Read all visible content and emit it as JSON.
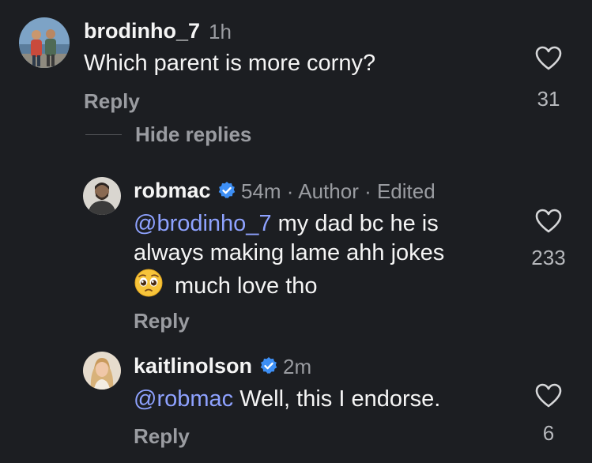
{
  "colors": {
    "background": "#1c1e22",
    "mention": "#8ea2ff",
    "verified_badge": "#3d8ff5",
    "secondary_text": "#9a9ca1"
  },
  "comment": {
    "username": "brodinho_7",
    "time": "1h",
    "text": "Which parent is more corny?",
    "reply_label": "Reply",
    "like_count": "31",
    "avatar_icon": "avatar-photo",
    "heart_icon": "heart-outline-icon"
  },
  "thread": {
    "hide_replies_label": "Hide replies"
  },
  "replies": [
    {
      "username": "robmac",
      "verified": true,
      "meta": "54m · Author · Edited",
      "mention": "@brodinho_7",
      "text_line1": " my  dad bc he is",
      "text_line2": "always making lame ahh jokes",
      "text_line3": "much love tho",
      "emoji_icon": "pleading-face-emoji",
      "reply_label": "Reply",
      "like_count": "233"
    },
    {
      "username": "kaitlinolson",
      "verified": true,
      "meta": "2m",
      "mention": "@robmac",
      "text": " Well, this I endorse.",
      "reply_label": "Reply",
      "like_count": "6"
    }
  ]
}
